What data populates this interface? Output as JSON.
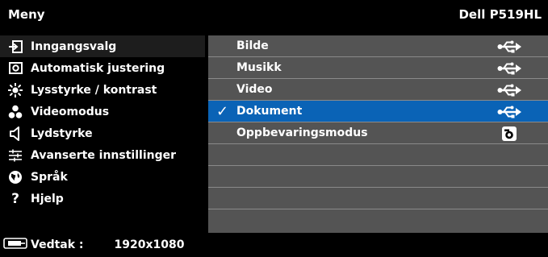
{
  "title": "Meny",
  "model": "Dell P519HL",
  "sidebar": {
    "items": [
      {
        "label": "Inngangsvalg",
        "icon": "input-source-icon"
      },
      {
        "label": "Automatisk justering",
        "icon": "auto-adjust-icon"
      },
      {
        "label": "Lysstyrke / kontrast",
        "icon": "brightness-icon"
      },
      {
        "label": "Videomodus",
        "icon": "video-mode-icon"
      },
      {
        "label": "Lydstyrke",
        "icon": "speaker-icon"
      },
      {
        "label": "Avanserte innstillinger",
        "icon": "sliders-icon"
      },
      {
        "label": "Språk",
        "icon": "language-icon"
      },
      {
        "label": "Hjelp",
        "icon": "help-icon"
      }
    ],
    "selected_index": 0
  },
  "main": {
    "rows": [
      {
        "label": "Bilde",
        "icon": "usb-icon"
      },
      {
        "label": "Musikk",
        "icon": "usb-icon"
      },
      {
        "label": "Video",
        "icon": "usb-icon"
      },
      {
        "label": "Dokument",
        "icon": "usb-icon",
        "checked": "✓"
      },
      {
        "label": "Oppbevaringsmodus",
        "icon": "storage-camera-icon"
      },
      {
        "label": ""
      },
      {
        "label": ""
      },
      {
        "label": ""
      },
      {
        "label": ""
      }
    ],
    "selected_index": 3
  },
  "status": {
    "resolution_label": "Vedtak :",
    "resolution_value": "1920x1080",
    "icon": "display-icon"
  },
  "colors": {
    "background": "#000000",
    "panel": "#545454",
    "highlight": "#0a63b6",
    "sidebar_selected": "#1d1d1d"
  }
}
